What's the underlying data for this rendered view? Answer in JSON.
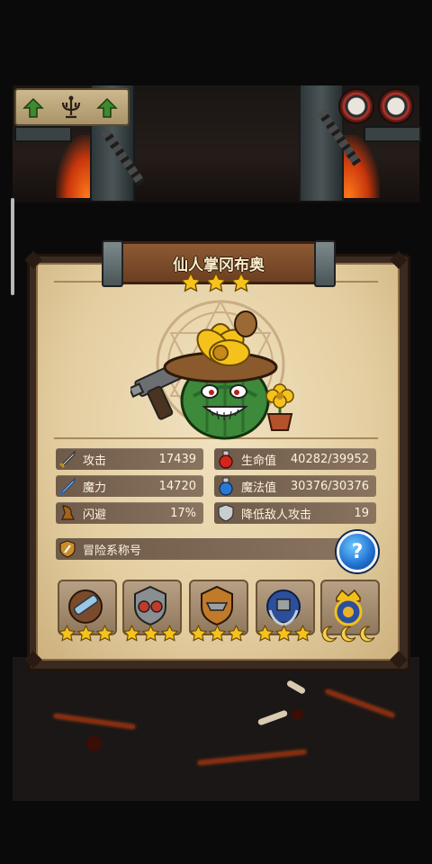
{
  "character": {
    "name": "仙人掌冈布奥",
    "rank_stars": 3
  },
  "stats": {
    "attack": {
      "label": "攻击",
      "value": "17439"
    },
    "magic": {
      "label": "魔力",
      "value": "14720"
    },
    "dodge": {
      "label": "闪避",
      "value": "17%"
    },
    "hp": {
      "label": "生命值",
      "value": "40282/39952"
    },
    "mp": {
      "label": "魔法值",
      "value": "30376/30376"
    },
    "enemy_attack_down": {
      "label": "降低敌人攻击",
      "value": "19"
    }
  },
  "adventure_title": {
    "label": "冒险系称号"
  },
  "help": {
    "label": "?"
  },
  "medals": [
    {
      "icon": "telescope-medal-icon",
      "stars": 3,
      "star_color": "gold"
    },
    {
      "icon": "goggles-medal-icon",
      "stars": 3,
      "star_color": "gold"
    },
    {
      "icon": "anvil-medal-icon",
      "stars": 3,
      "star_color": "gold"
    },
    {
      "icon": "laurel-medal-icon",
      "stars": 3,
      "star_color": "gold"
    },
    {
      "icon": "crown-medal-icon",
      "stars": 3,
      "star_color": "moon"
    }
  ],
  "colors": {
    "accent_gold": "#f6c21c",
    "panel_bg": "#e9d6b0",
    "banner_wood": "#7a4a2a",
    "stat_bar": "#7d6753",
    "help_blue": "#1f6fd0"
  }
}
